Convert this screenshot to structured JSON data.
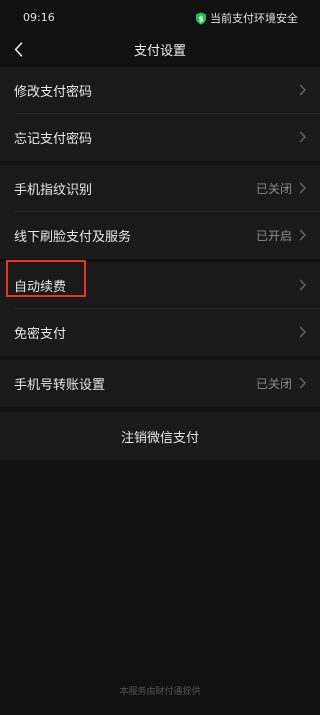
{
  "status_bar": {
    "time": "09:16",
    "security_text": "当前支付环境安全",
    "shield_icon": "shield-dollar-icon",
    "shield_color": "#2ebd59"
  },
  "nav": {
    "back_icon": "chevron-left-icon",
    "title": "支付设置"
  },
  "groups": [
    {
      "items": [
        {
          "label": "修改支付密码",
          "value": ""
        },
        {
          "label": "忘记支付密码",
          "value": ""
        }
      ]
    },
    {
      "items": [
        {
          "label": "手机指纹识别",
          "value": "已关闭"
        },
        {
          "label": "线下刷脸支付及服务",
          "value": "已开启"
        }
      ]
    },
    {
      "items": [
        {
          "label": "自动续费",
          "value": "",
          "highlighted": true
        },
        {
          "label": "免密支付",
          "value": ""
        }
      ]
    },
    {
      "items": [
        {
          "label": "手机号转账设置",
          "value": "已关闭"
        }
      ]
    }
  ],
  "logout_label": "注销微信支付",
  "footer": "本服务由财付通提供",
  "colors": {
    "background": "#111111",
    "row_background": "#1a1a1a",
    "highlight_border": "#e53822"
  }
}
